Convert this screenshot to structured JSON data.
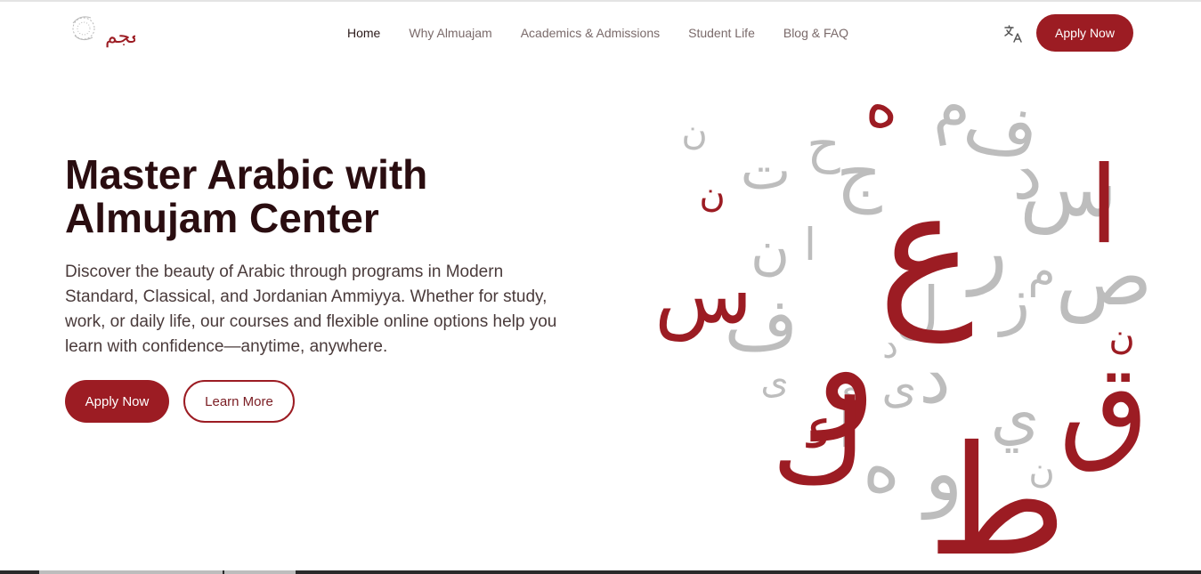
{
  "brand": {
    "logo_name": "المعجم",
    "logo_icon": "almujam-logo"
  },
  "nav": {
    "items": [
      {
        "label": "Home",
        "active": true
      },
      {
        "label": "Why Almuajam",
        "active": false
      },
      {
        "label": "Academics & Admissions",
        "active": false
      },
      {
        "label": "Student Life",
        "active": false
      },
      {
        "label": "Blog & FAQ",
        "active": false
      }
    ],
    "translate_icon": "translate-icon",
    "apply_label": "Apply Now"
  },
  "hero": {
    "title_line1": "Master Arabic with",
    "title_line2": "Almujam Center",
    "description": "Discover the beauty of Arabic through programs in Modern Standard, Classical, and Jordanian Ammiyya. Whether for study, work, or daily life, our courses and flexible online options help you learn with confidence—anytime, anywhere.",
    "primary_button": "Apply Now",
    "secondary_button": "Learn More"
  },
  "colors": {
    "accent": "#9c1c23",
    "heading": "#2a0d10",
    "letter_grey": "#bdbdbd"
  },
  "illustration": {
    "name": "arabic-letters-illustration",
    "letters_red": [
      "ع",
      "و",
      "ك",
      "ط",
      "ق",
      "س",
      "ا",
      "ه",
      "ن",
      "ن"
    ],
    "letters_grey": [
      "م",
      "ف",
      "د",
      "س",
      "ج",
      "ح",
      "ت",
      "ن",
      "ر",
      "ز",
      "ص",
      "م",
      "ا",
      "ف",
      "ن",
      "ل",
      "د",
      "ي",
      "د",
      "ى",
      "ه",
      "و",
      "ا",
      "ن",
      "ى",
      "ى"
    ]
  }
}
